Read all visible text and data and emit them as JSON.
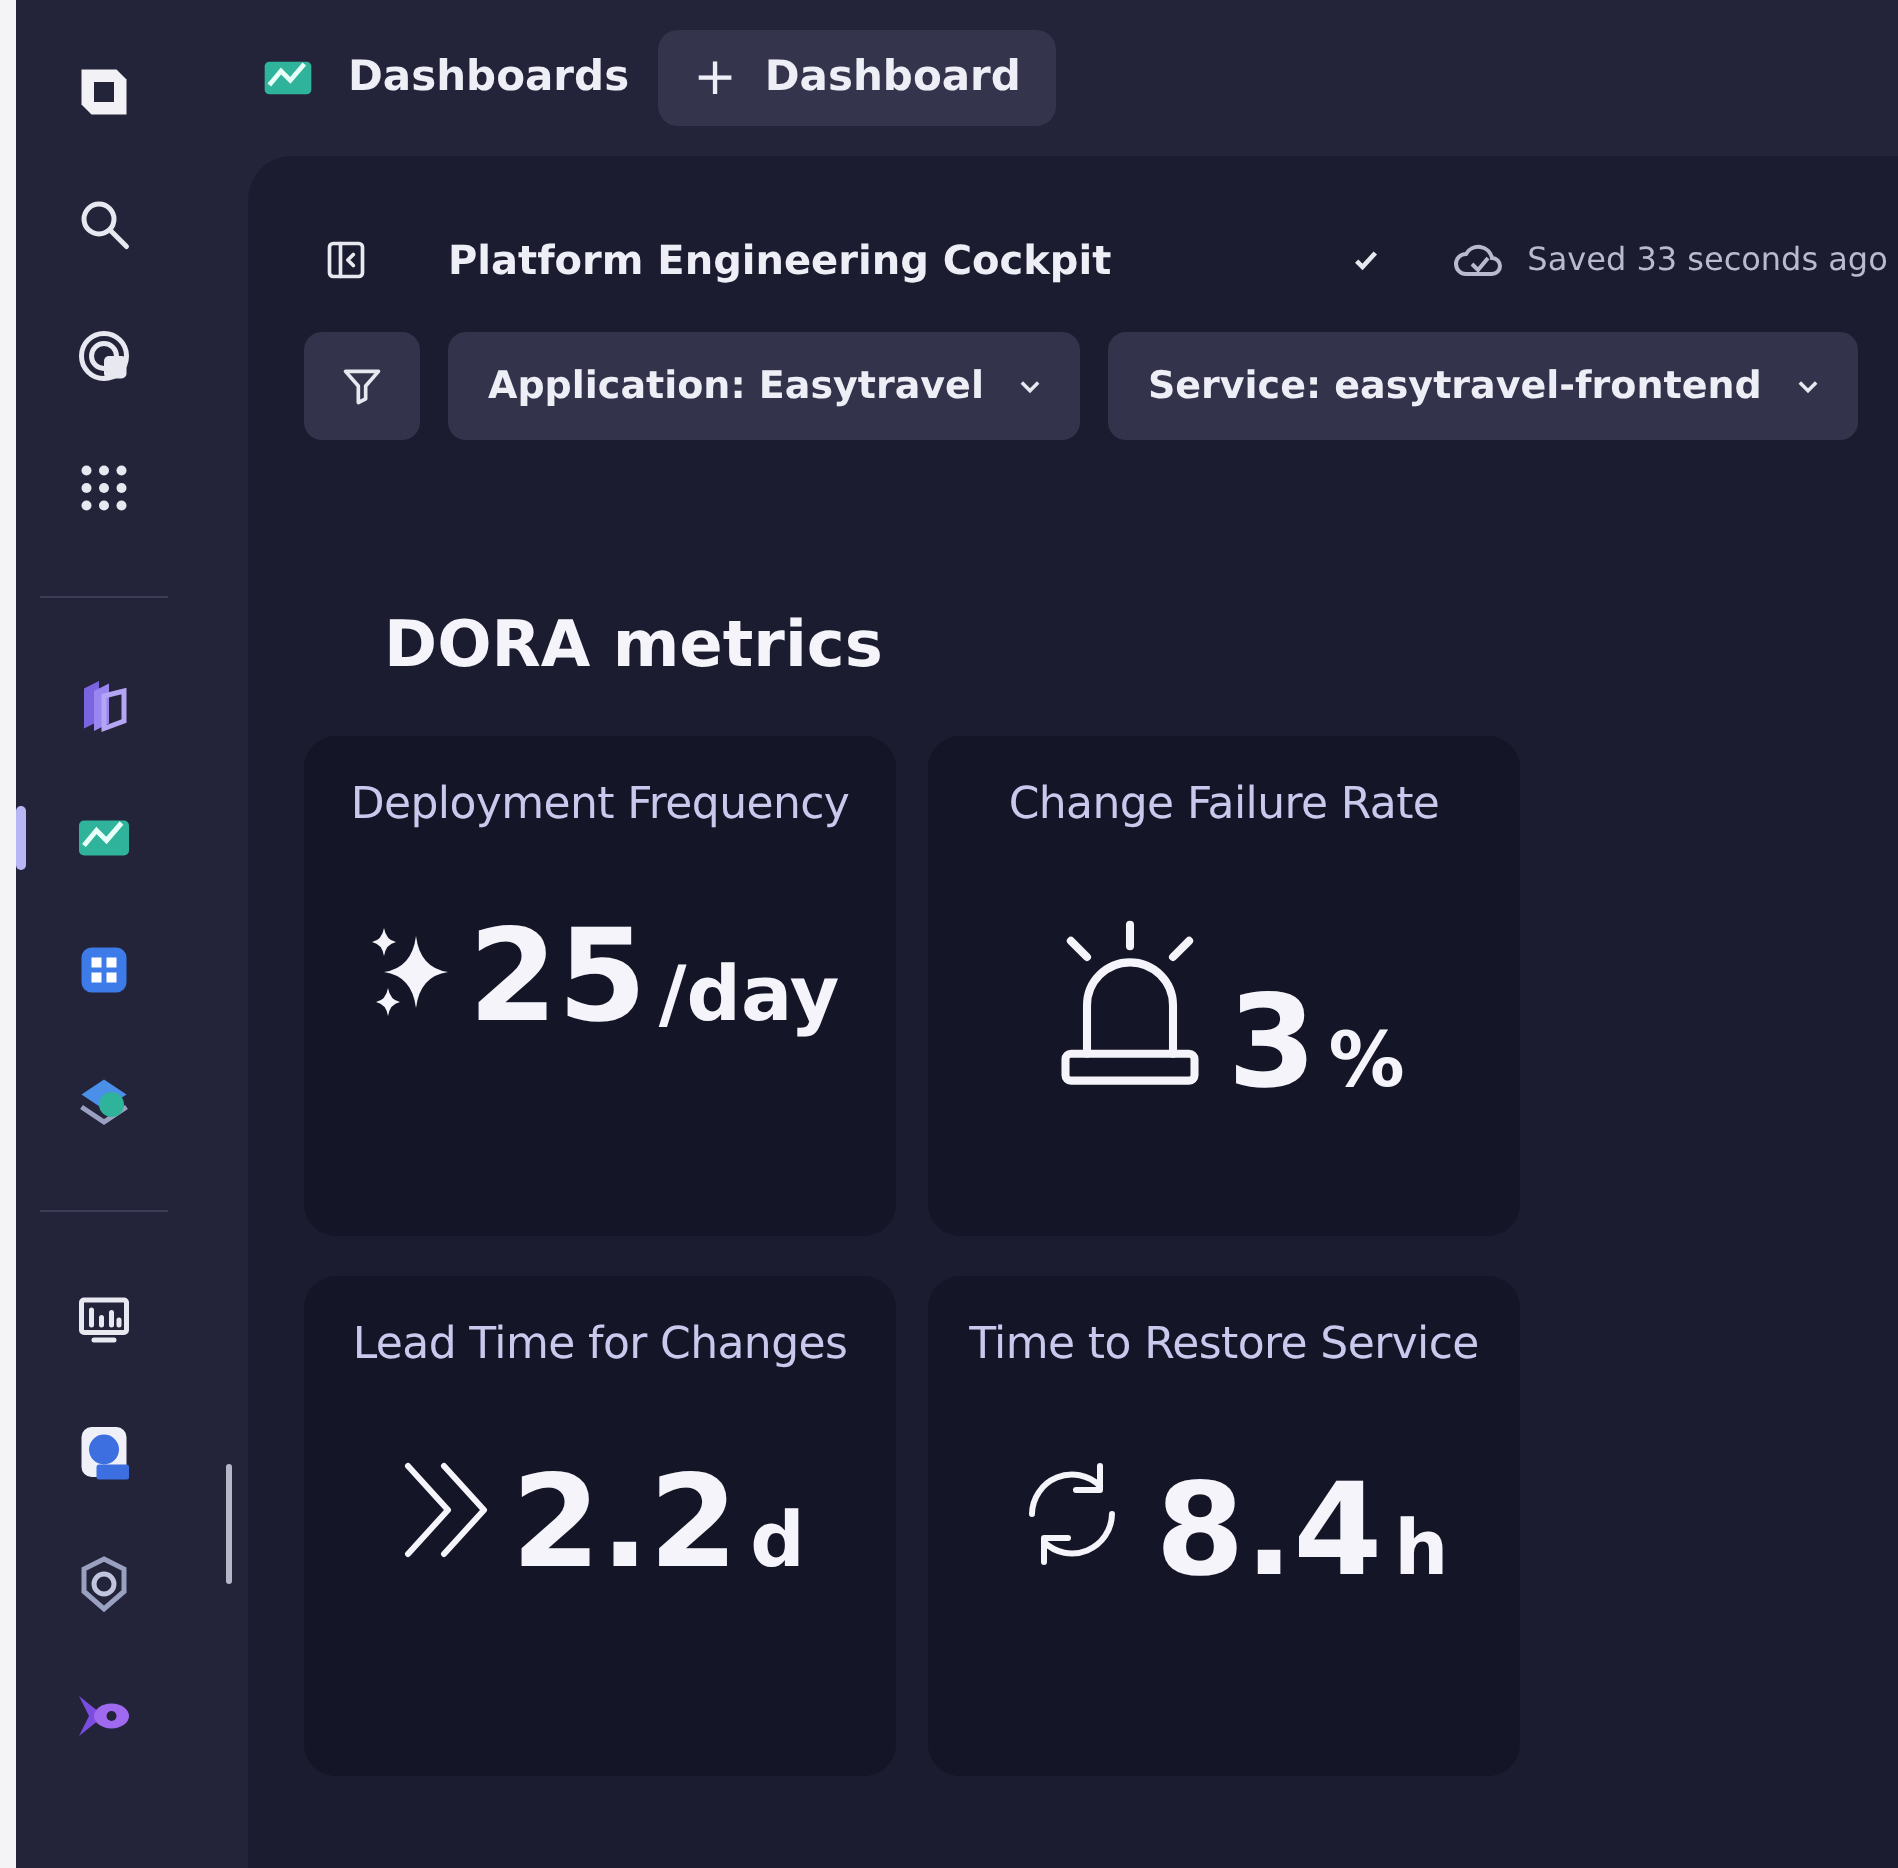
{
  "sidebar": {
    "groups": [
      {
        "items": [
          {
            "selected": false
          },
          {
            "selected": false
          },
          {
            "selected": false
          },
          {
            "selected": false
          }
        ]
      },
      {
        "items": [
          {
            "selected": false
          },
          {
            "selected": true
          },
          {
            "selected": false
          },
          {
            "selected": false
          }
        ]
      },
      {
        "items": [
          {
            "selected": false
          },
          {
            "selected": false
          },
          {
            "selected": false
          },
          {
            "selected": false
          }
        ]
      }
    ]
  },
  "header": {
    "app": "Dashboards",
    "tab": {
      "plus": "+",
      "label": "Dashboard"
    }
  },
  "dashboard": {
    "title": "Platform Engineering Cockpit",
    "saved": "Saved 33 seconds ago",
    "filters": [
      {
        "label": "Application: Easytravel"
      },
      {
        "label": "Service: easytravel-frontend"
      }
    ],
    "section": "DORA metrics",
    "tiles": [
      {
        "title": "Deployment Frequency",
        "value": "25",
        "unit": "/day"
      },
      {
        "title": "Change Failure Rate",
        "value": "3",
        "unit": "%"
      },
      {
        "title": "Lead Time for Changes",
        "value": "2.2",
        "unit": "d"
      },
      {
        "title": "Time to Restore Service",
        "value": "8.4",
        "unit": "h"
      }
    ]
  }
}
